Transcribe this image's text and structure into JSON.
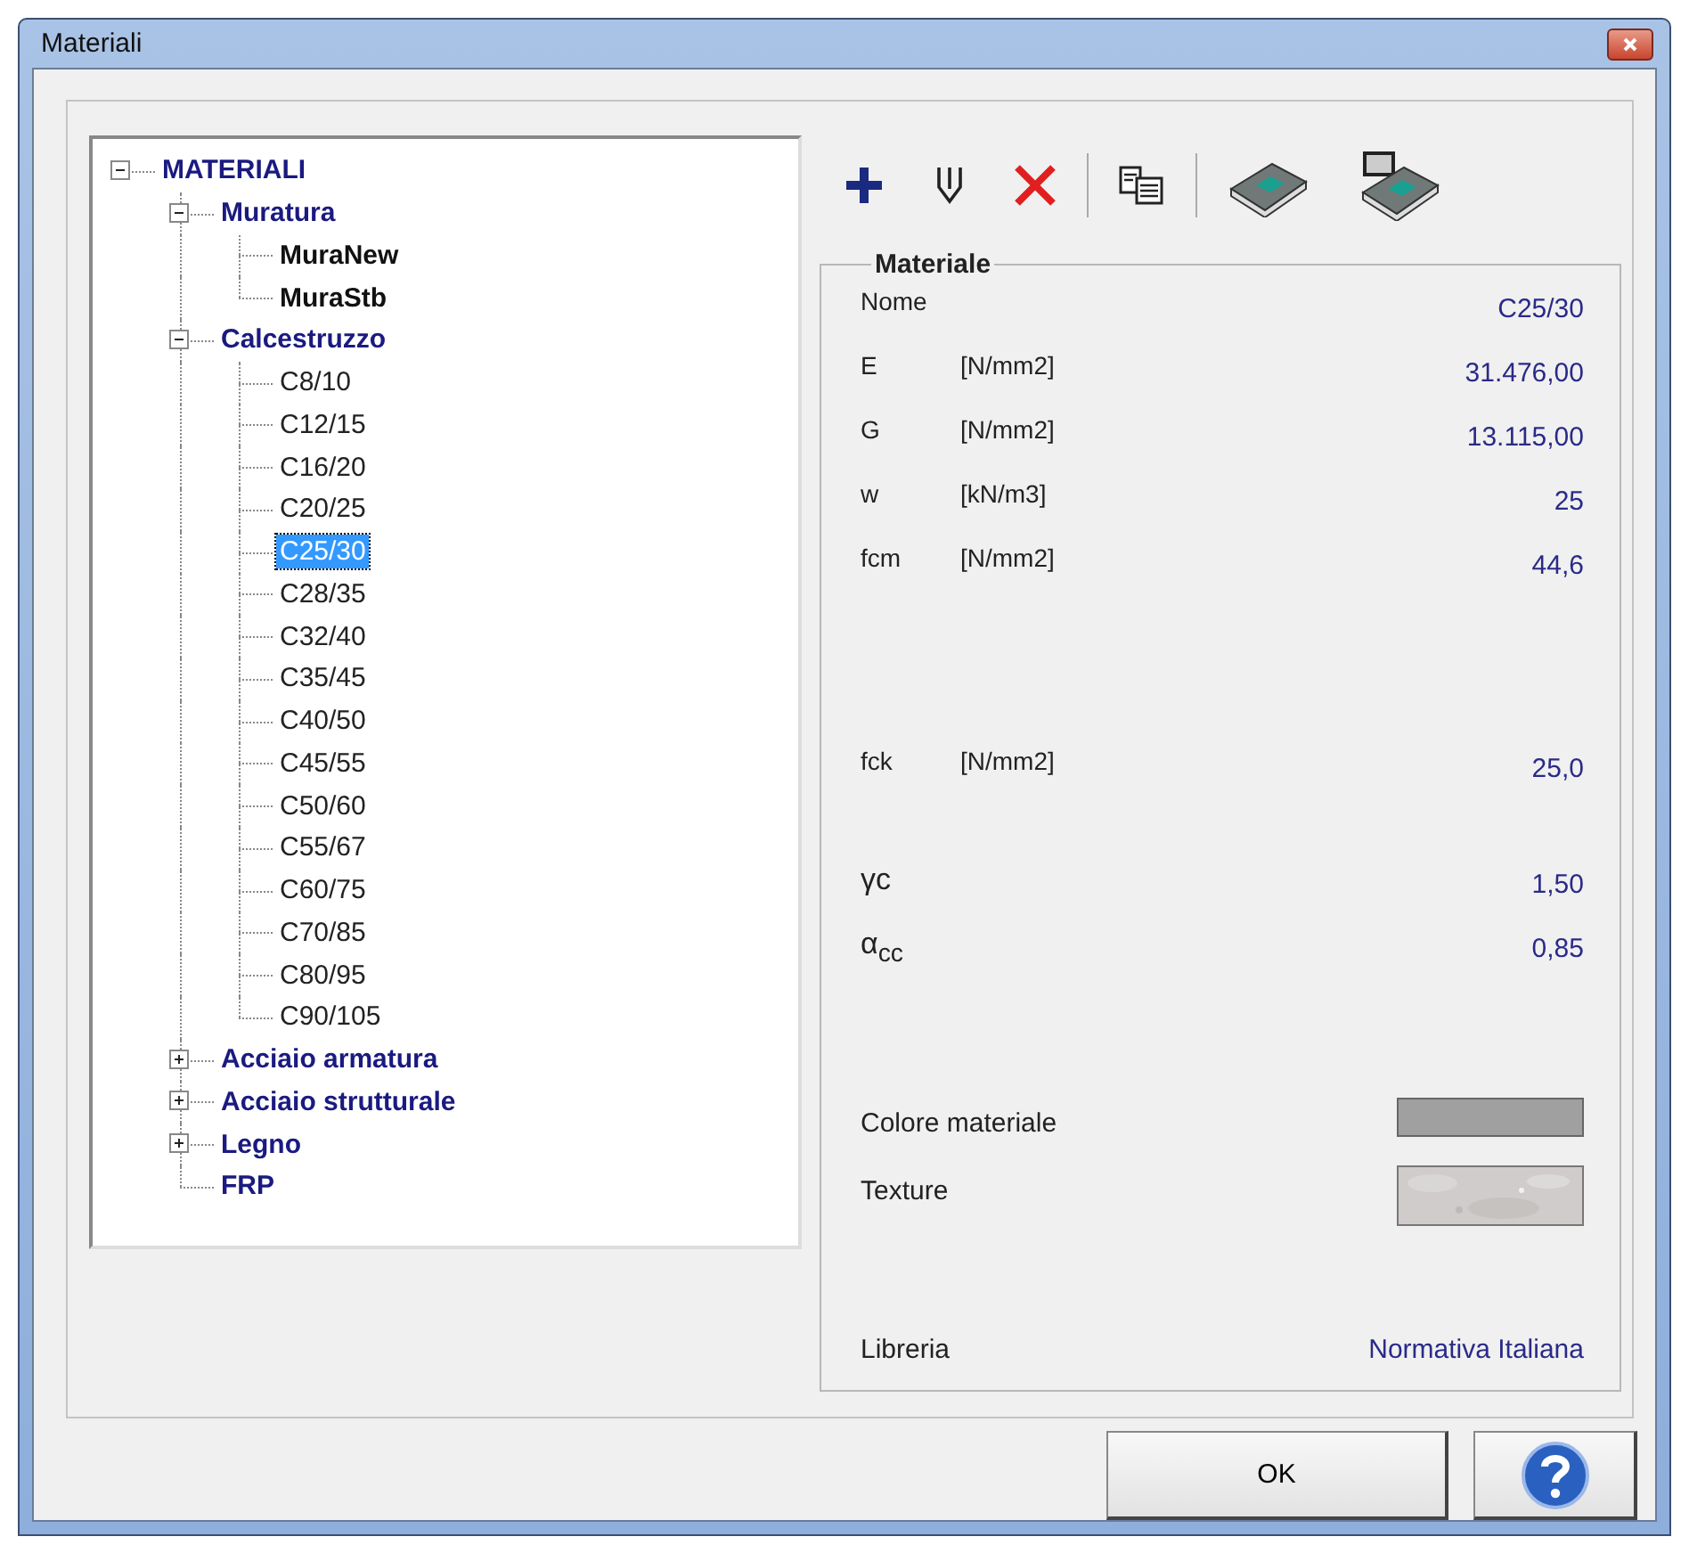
{
  "window": {
    "title": "Materiali"
  },
  "tree": [
    {
      "label": "MATERIALI",
      "kind": "category",
      "expanded": true,
      "selected": false,
      "children": [
        {
          "label": "Muratura",
          "kind": "category",
          "expanded": true,
          "selected": false,
          "children": [
            {
              "label": "MuraNew",
              "kind": "custom",
              "selected": false
            },
            {
              "label": "MuraStb",
              "kind": "custom",
              "selected": false
            }
          ]
        },
        {
          "label": "Calcestruzzo",
          "kind": "category",
          "expanded": true,
          "selected": false,
          "children": [
            {
              "label": "C8/10",
              "kind": "standard",
              "selected": false
            },
            {
              "label": "C12/15",
              "kind": "standard",
              "selected": false
            },
            {
              "label": "C16/20",
              "kind": "standard",
              "selected": false
            },
            {
              "label": "C20/25",
              "kind": "standard",
              "selected": false
            },
            {
              "label": "C25/30",
              "kind": "standard",
              "selected": true
            },
            {
              "label": "C28/35",
              "kind": "standard",
              "selected": false
            },
            {
              "label": "C32/40",
              "kind": "standard",
              "selected": false
            },
            {
              "label": "C35/45",
              "kind": "standard",
              "selected": false
            },
            {
              "label": "C40/50",
              "kind": "standard",
              "selected": false
            },
            {
              "label": "C45/55",
              "kind": "standard",
              "selected": false
            },
            {
              "label": "C50/60",
              "kind": "standard",
              "selected": false
            },
            {
              "label": "C55/67",
              "kind": "standard",
              "selected": false
            },
            {
              "label": "C60/75",
              "kind": "standard",
              "selected": false
            },
            {
              "label": "C70/85",
              "kind": "standard",
              "selected": false
            },
            {
              "label": "C80/95",
              "kind": "standard",
              "selected": false
            },
            {
              "label": "C90/105",
              "kind": "standard",
              "selected": false
            }
          ]
        },
        {
          "label": "Acciaio armatura",
          "kind": "category",
          "expanded": false,
          "selected": false
        },
        {
          "label": "Acciaio strutturale",
          "kind": "category",
          "expanded": false,
          "selected": false
        },
        {
          "label": "Legno",
          "kind": "category",
          "expanded": false,
          "selected": false
        },
        {
          "label": "FRP",
          "kind": "category",
          "selected": false
        }
      ]
    }
  ],
  "toolbar": [
    {
      "kind": "add"
    },
    {
      "kind": "edit"
    },
    {
      "kind": "delete"
    },
    {
      "kind": "separator"
    },
    {
      "kind": "copy"
    },
    {
      "kind": "separator"
    },
    {
      "kind": "library"
    },
    {
      "kind": "library-save"
    }
  ],
  "group_title": "Materiale",
  "property_groups": [
    [
      {
        "symbol": "Nome",
        "value": "C25/30"
      },
      {
        "symbol": "E",
        "unit": "[N/mm2]",
        "value": "31.476,00"
      },
      {
        "symbol": "G",
        "unit": "[N/mm2]",
        "value": "13.115,00"
      },
      {
        "symbol": "w",
        "unit": "[kN/m3]",
        "value": "25"
      },
      {
        "symbol": "fcm",
        "unit": "[N/mm2]",
        "value": "44,6"
      }
    ],
    [
      {
        "symbol": "fck",
        "unit": "[N/mm2]",
        "value": "25,0"
      }
    ],
    [
      {
        "symbol": "γc",
        "value": "1,50"
      },
      {
        "symbol": "α$_{cc}$",
        "value": "0,85"
      }
    ]
  ],
  "color_row": {
    "label": "Colore materiale",
    "color": "#a0a0a0"
  },
  "texture_row": {
    "label": "Texture",
    "kind": "picture"
  },
  "library": {
    "label": "Libreria",
    "value": "Normativa Italiana"
  },
  "buttons": {
    "ok": "OK"
  }
}
